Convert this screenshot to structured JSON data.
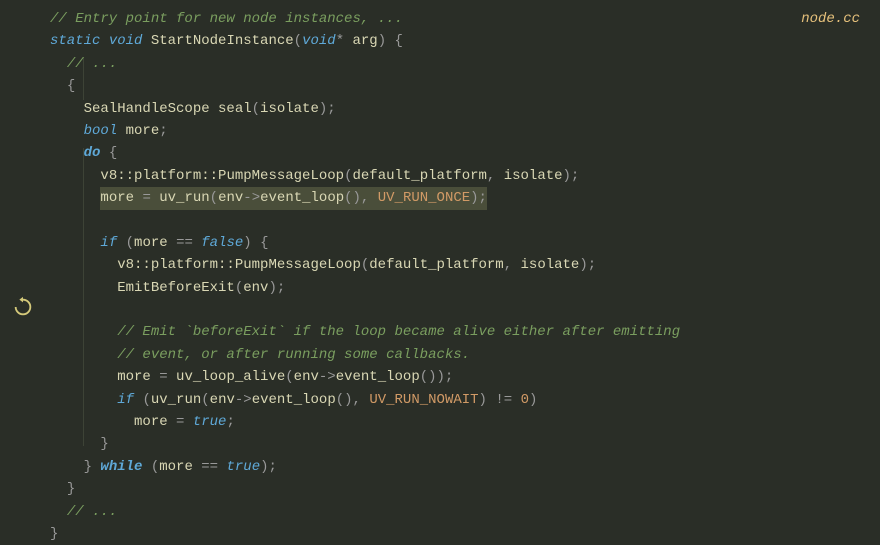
{
  "filename": "node.cc",
  "code": {
    "l1_comment": "// Entry point for new node instances, ...",
    "l2_kw_static": "static",
    "l2_kw_void": "void",
    "l2_func": "StartNodeInstance",
    "l2_kw_void2": "void",
    "l2_arg": "arg",
    "l3_comment": "// ...",
    "l5_seal": "SealHandleScope seal",
    "l5_isolate": "isolate",
    "l6_bool": "bool",
    "l6_more": "more",
    "l7_do": "do",
    "l8_ns": "v8::platform::",
    "l8_fn": "PumpMessageLoop",
    "l8_a1": "default_platform",
    "l8_a2": "isolate",
    "l9_more": "more",
    "l9_fn": "uv_run",
    "l9_env": "env",
    "l9_el": "event_loop",
    "l9_mode": "UV_RUN_ONCE",
    "l11_if": "if",
    "l11_more": "more",
    "l11_false": "false",
    "l12_ns": "v8::platform::",
    "l12_fn": "PumpMessageLoop",
    "l12_a1": "default_platform",
    "l12_a2": "isolate",
    "l13_fn": "EmitBeforeExit",
    "l13_env": "env",
    "l15_c1": "// Emit `beforeExit` if the loop became alive either after emitting",
    "l16_c2": "// event, or after running some callbacks.",
    "l17_more": "more",
    "l17_fn": "uv_loop_alive",
    "l17_env": "env",
    "l17_el": "event_loop",
    "l18_if": "if",
    "l18_fn": "uv_run",
    "l18_env": "env",
    "l18_el": "event_loop",
    "l18_mode": "UV_RUN_NOWAIT",
    "l18_zero": "0",
    "l19_more": "more",
    "l19_true": "true",
    "l21_while": "while",
    "l21_more": "more",
    "l21_true": "true",
    "l23_comment": "// ..."
  }
}
